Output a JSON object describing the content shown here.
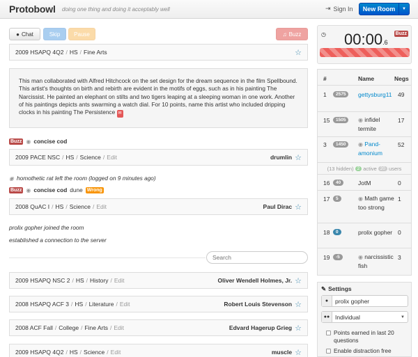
{
  "navbar": {
    "brand": "Protobowl",
    "tagline": "doing one thing and doing it acceptably well",
    "signin_label": "Sign In",
    "new_room_label": "New Room"
  },
  "toolbar": {
    "chat_label": "Chat",
    "skip_label": "Skip",
    "pause_label": "Pause",
    "buzz_label": "Buzz"
  },
  "current_question": {
    "crumbs": [
      "2009 HSAPQ 4Q2",
      "HS",
      "Fine Arts"
    ],
    "text": "This man collaborated with Alfred Hitchcock on the set design for the dream sequence in the film Spellbound. This artist's thoughts on birth and rebirth are evident in the motifs of eggs, such as in his painting The Narcissist. He painted an elephant on stilts and two tigers leaping at a sleeping woman in one work. Another of his paintings depicts ants swarming a watch dial. For 10 points, name this artist who included dripping clocks in his painting The Persistence"
  },
  "log": {
    "buzz1_label": "Buzz",
    "buzz1_user": "concise cod",
    "left_msg": "homothetic rat left the room (logged on 9 minutes ago)",
    "buzz2_label": "Buzz",
    "buzz2_user": "concise cod",
    "buzz2_guess": "dune",
    "wrong_label": "Wrong",
    "joined_msg": "prolix gopher joined the room",
    "connected_msg": "established a connection to the server"
  },
  "history": [
    {
      "crumbs": [
        "2009 PACE NSC",
        "HS",
        "Science",
        "Edit"
      ],
      "answer": "drumlin"
    },
    {
      "crumbs": [
        "2008 QuAC I",
        "HS",
        "Science",
        "Edit"
      ],
      "answer": "Paul Dirac"
    },
    {
      "crumbs": [
        "2009 HSAPQ NSC 2",
        "HS",
        "History",
        "Edit"
      ],
      "answer": "Oliver Wendell Holmes, Jr."
    },
    {
      "crumbs": [
        "2008 HSAPQ ACF 3",
        "HS",
        "Literature",
        "Edit"
      ],
      "answer": "Robert Louis Stevenson"
    },
    {
      "crumbs": [
        "2008 ACF Fall",
        "College",
        "Fine Arts",
        "Edit"
      ],
      "answer": "Edvard Hagerup Grieg"
    },
    {
      "crumbs": [
        "2009 HSAPQ 4Q2",
        "HS",
        "Science",
        "Edit"
      ],
      "answer": "muscle"
    }
  ],
  "search": {
    "placeholder": "Search"
  },
  "timer": {
    "seconds": "00:00",
    "tenths": ".6",
    "buzz_label": "Buzz"
  },
  "leaderboard": {
    "headers": {
      "idx": "#",
      "name": "Name",
      "negs": "Negs"
    },
    "rows": [
      {
        "idx": "1",
        "score": "2575",
        "name": "gettysburg11",
        "negs": "49"
      },
      {
        "idx": "15",
        "score": "1505",
        "name": "infidel termite",
        "negs": "17"
      },
      {
        "idx": "3",
        "score": "1450",
        "name": "Pand-amonium",
        "negs": "52"
      }
    ],
    "hidden": {
      "hidden_text": "(13 hidden)",
      "active_count": "2",
      "active_label": "active",
      "users_count": "20",
      "users_label": "users"
    },
    "rows2": [
      {
        "idx": "16",
        "score": "40",
        "name": "JotM",
        "negs": "0"
      },
      {
        "idx": "17",
        "score": "5",
        "name": "Math game too strong",
        "negs": "1"
      },
      {
        "idx": "18",
        "score": "0",
        "name": "prolix gopher",
        "negs": "0"
      },
      {
        "idx": "19",
        "score": "-5",
        "name": "narcissistic fish",
        "negs": "3"
      }
    ]
  },
  "settings": {
    "title": "Settings",
    "username": "prolix gopher",
    "mode": "Individual",
    "check1": "Points earned in last 20 questions",
    "check2": "Enable distraction free"
  }
}
